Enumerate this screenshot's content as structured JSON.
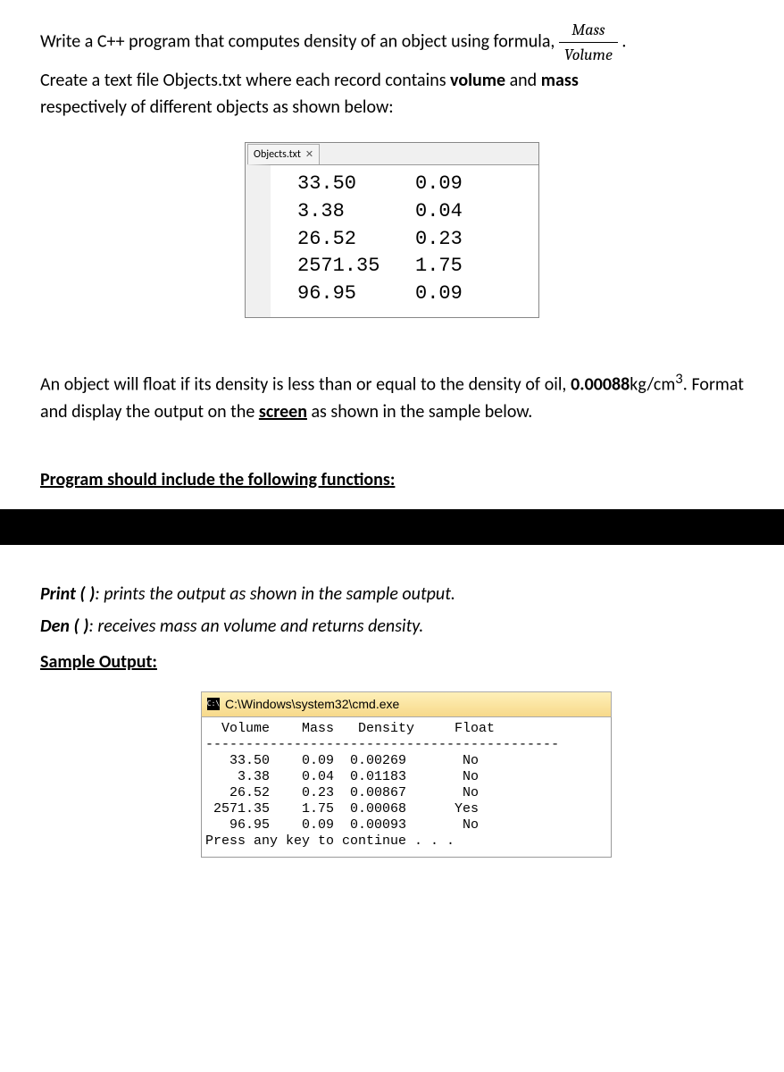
{
  "intro": {
    "line1_prefix": "Write a C++ program that computes density of an object using formula, ",
    "formula_num": "Mass",
    "formula_den": "Volume",
    "line2": "Create a text file Objects.txt where each record contains ",
    "line2_bold1": "volume",
    "line2_mid": " and ",
    "line2_bold2": "mass",
    "line3": "respectively  of different objects as shown below:"
  },
  "file_tab_label": "Objects.txt",
  "file_tab_x": "✕",
  "file_rows": [
    {
      "vol": "33.50",
      "mass": "0.09"
    },
    {
      "vol": "3.38",
      "mass": "0.04"
    },
    {
      "vol": "26.52",
      "mass": "0.23"
    },
    {
      "vol": "2571.35",
      "mass": "1.75"
    },
    {
      "vol": "96.95",
      "mass": "0.09"
    }
  ],
  "para2": {
    "text1": "An object will float if its density is less than or equal to the density of oil, ",
    "value_bold": "0.00088",
    "unit": "kg/cm",
    "sup": "3",
    "text2": ".  Format and display the output on the ",
    "screen_word": "screen",
    "text3": " as shown in the sample below."
  },
  "func_heading": "Program should include the following functions:",
  "print_line_pre": "Print ( )",
  "print_line_rest": ": prints the output as shown in the sample output.",
  "den_line_pre": "Den ( )",
  "den_line_rest": ":  receives mass an volume and returns density.",
  "sample_heading": "Sample Output:",
  "cmd_title": "C:\\Windows\\system32\\cmd.exe",
  "cmd_header": {
    "vol": "Volume",
    "mass": "Mass",
    "den": "Density",
    "float": "Float"
  },
  "cmd_sep": "--------------------------------------------",
  "cmd_rows": [
    {
      "vol": "33.50",
      "mass": "0.09",
      "den": "0.00269",
      "float": "No"
    },
    {
      "vol": "3.38",
      "mass": "0.04",
      "den": "0.01183",
      "float": "No"
    },
    {
      "vol": "26.52",
      "mass": "0.23",
      "den": "0.00867",
      "float": "No"
    },
    {
      "vol": "2571.35",
      "mass": "1.75",
      "den": "0.00068",
      "float": "Yes"
    },
    {
      "vol": "96.95",
      "mass": "0.09",
      "den": "0.00093",
      "float": "No"
    }
  ],
  "cmd_footer": "Press any key to continue . . ."
}
